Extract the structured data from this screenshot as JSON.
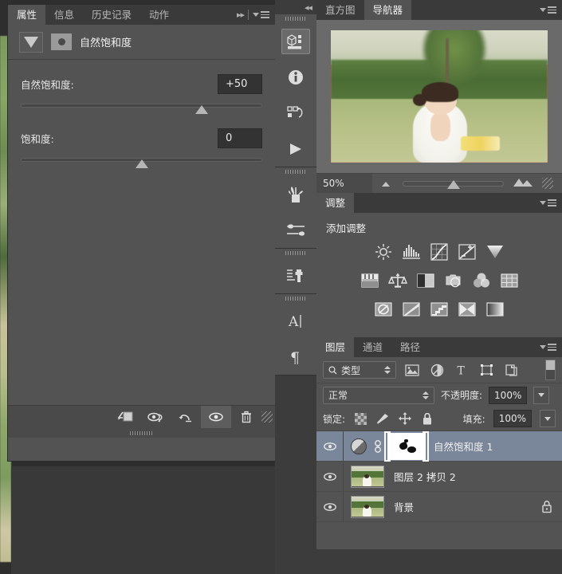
{
  "canvas": {
    "background_color": "#393939"
  },
  "properties_panel": {
    "tabs": [
      {
        "label": "属性",
        "active": true
      },
      {
        "label": "信息",
        "active": false
      },
      {
        "label": "历史记录",
        "active": false
      },
      {
        "label": "动作",
        "active": false
      }
    ],
    "overflow_label": "▸▸",
    "header_title": "自然饱和度",
    "controls": [
      {
        "label": "自然饱和度:",
        "value": "+50",
        "slider_percent": 75
      },
      {
        "label": "饱和度:",
        "value": "0",
        "slider_percent": 50
      }
    ],
    "footer_icons": [
      {
        "name": "clip-to-layer-icon",
        "active": false
      },
      {
        "name": "preview-toggle-icon",
        "active": false
      },
      {
        "name": "reset-icon",
        "active": false
      },
      {
        "name": "visibility-eye-icon",
        "active": true
      },
      {
        "name": "delete-trash-icon",
        "active": false
      }
    ]
  },
  "icon_dock": {
    "collapse_label": "◂◂",
    "groups": [
      {
        "buttons": [
          {
            "name": "3d-panel-icon",
            "selected": true
          },
          {
            "name": "info-icon",
            "selected": false
          },
          {
            "name": "history-icon",
            "selected": false
          },
          {
            "name": "actions-play-icon",
            "selected": false
          }
        ]
      },
      {
        "buttons": [
          {
            "name": "brush-presets-icon",
            "selected": false
          },
          {
            "name": "brush-settings-icon",
            "selected": false
          }
        ]
      },
      {
        "buttons": [
          {
            "name": "clone-source-icon",
            "selected": false
          }
        ]
      },
      {
        "buttons": [
          {
            "name": "character-icon",
            "selected": false
          },
          {
            "name": "paragraph-icon",
            "selected": false
          }
        ]
      }
    ]
  },
  "navigator_panel": {
    "tabs": [
      {
        "label": "直方图",
        "active": false
      },
      {
        "label": "导航器",
        "active": true
      }
    ],
    "zoom_value": "50%",
    "zoom_slider_percent": 50,
    "view_box_color": "#f0504a",
    "zoom_out_icon": "small-mountain-icon",
    "zoom_in_icon": "large-mountain-icon"
  },
  "adjustments_panel": {
    "tab_label": "调整",
    "section_title": "添加调整",
    "rows": [
      [
        {
          "name": "brightness-contrast-icon"
        },
        {
          "name": "levels-icon"
        },
        {
          "name": "curves-icon"
        },
        {
          "name": "exposure-icon"
        },
        {
          "name": "vibrance-icon"
        }
      ],
      [
        {
          "name": "hue-saturation-icon"
        },
        {
          "name": "color-balance-icon"
        },
        {
          "name": "black-white-icon"
        },
        {
          "name": "photo-filter-icon"
        },
        {
          "name": "channel-mixer-icon"
        },
        {
          "name": "color-lookup-icon"
        }
      ],
      [
        {
          "name": "invert-icon"
        },
        {
          "name": "posterize-icon"
        },
        {
          "name": "threshold-icon"
        },
        {
          "name": "selective-color-icon"
        },
        {
          "name": "gradient-map-icon"
        }
      ]
    ]
  },
  "layers_panel": {
    "tabs": [
      {
        "label": "图层",
        "active": true
      },
      {
        "label": "通道",
        "active": false
      },
      {
        "label": "路径",
        "active": false
      }
    ],
    "filter": {
      "type_label": "类型",
      "search_icon": "search-icon",
      "icons": [
        {
          "name": "filter-pixel-layers-icon"
        },
        {
          "name": "filter-adjustment-layers-icon"
        },
        {
          "name": "filter-type-layers-icon"
        },
        {
          "name": "filter-shape-layers-icon"
        },
        {
          "name": "filter-smart-object-icon"
        }
      ],
      "toggle_name": "filter-enable-toggle"
    },
    "blend_mode": "正常",
    "opacity_label": "不透明度:",
    "opacity_value": "100%",
    "lock_label": "锁定:",
    "lock_icons": [
      {
        "name": "lock-transparent-pixels-icon"
      },
      {
        "name": "lock-image-pixels-icon"
      },
      {
        "name": "lock-position-icon"
      },
      {
        "name": "lock-all-icon"
      }
    ],
    "fill_label": "填充:",
    "fill_value": "100%",
    "layers": [
      {
        "name": "自然饱和度 1",
        "type": "adjustment",
        "selected": true,
        "visible": true,
        "locked": false,
        "has_mask": true,
        "link_icon": "link-layers-icon"
      },
      {
        "name": "图层 2 拷贝 2",
        "type": "pixel",
        "selected": false,
        "visible": true,
        "locked": false,
        "has_mask": false
      },
      {
        "name": "背景",
        "type": "pixel",
        "selected": false,
        "visible": true,
        "locked": true,
        "has_mask": false,
        "lock_icon": "lock-icon"
      }
    ]
  }
}
